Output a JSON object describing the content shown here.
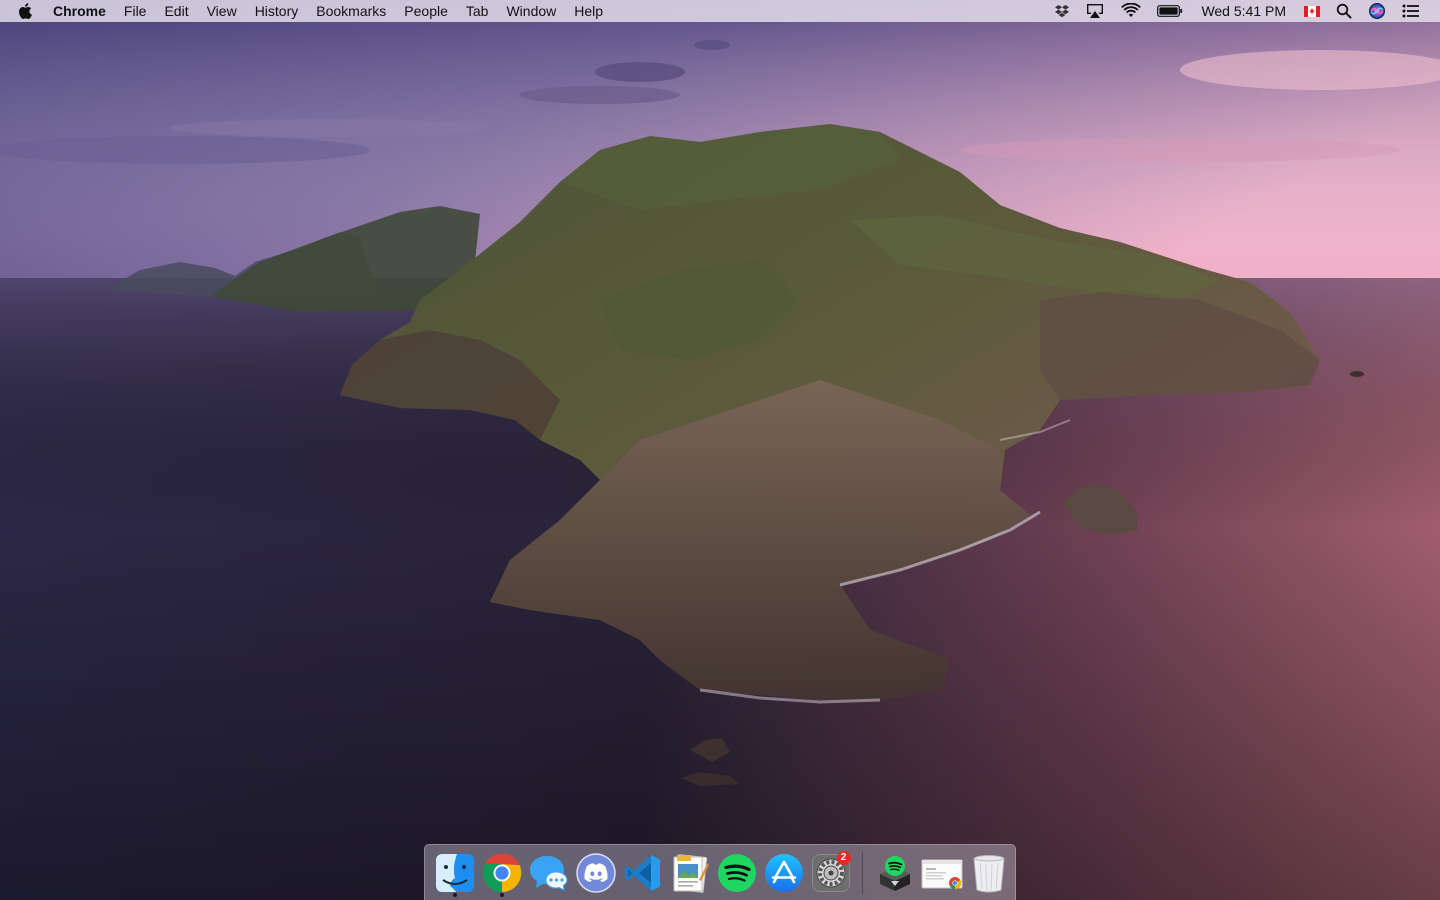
{
  "menubar": {
    "app_name": "Chrome",
    "menus": [
      "File",
      "Edit",
      "View",
      "History",
      "Bookmarks",
      "People",
      "Tab",
      "Window",
      "Help"
    ],
    "clock": "Wed 5:41 PM",
    "status_icons": [
      "dropbox-icon",
      "airplay-icon",
      "wifi-icon",
      "battery-icon",
      "canada-flag-icon",
      "spotlight-icon",
      "siri-icon",
      "control-center-icon"
    ]
  },
  "dock": {
    "apps": [
      {
        "name": "Finder",
        "icon": "finder-icon",
        "running": true
      },
      {
        "name": "Google Chrome",
        "icon": "chrome-icon",
        "running": true
      },
      {
        "name": "Messenger",
        "icon": "messenger-icon",
        "running": false
      },
      {
        "name": "Discord",
        "icon": "discord-icon",
        "running": false
      },
      {
        "name": "Visual Studio Code",
        "icon": "vscode-icon",
        "running": false
      },
      {
        "name": "Preview",
        "icon": "preview-icon",
        "running": false
      },
      {
        "name": "Spotify",
        "icon": "spotify-icon",
        "running": false
      },
      {
        "name": "App Store",
        "icon": "app-store-icon",
        "running": false
      },
      {
        "name": "System Preferences",
        "icon": "system-preferences-icon",
        "running": false,
        "badge": "2"
      }
    ],
    "others": [
      {
        "name": "Spotify Installer",
        "icon": "spotify-installer-icon"
      },
      {
        "name": "Chrome Document",
        "icon": "chrome-document-icon"
      },
      {
        "name": "Trash",
        "icon": "trash-icon"
      }
    ]
  },
  "colors": {
    "sky_top": "#5b4f86",
    "sky_right": "#e2a0bd",
    "sea_left": "#27223f",
    "sea_right": "#8c4e5e",
    "badge": "#e62a23"
  }
}
